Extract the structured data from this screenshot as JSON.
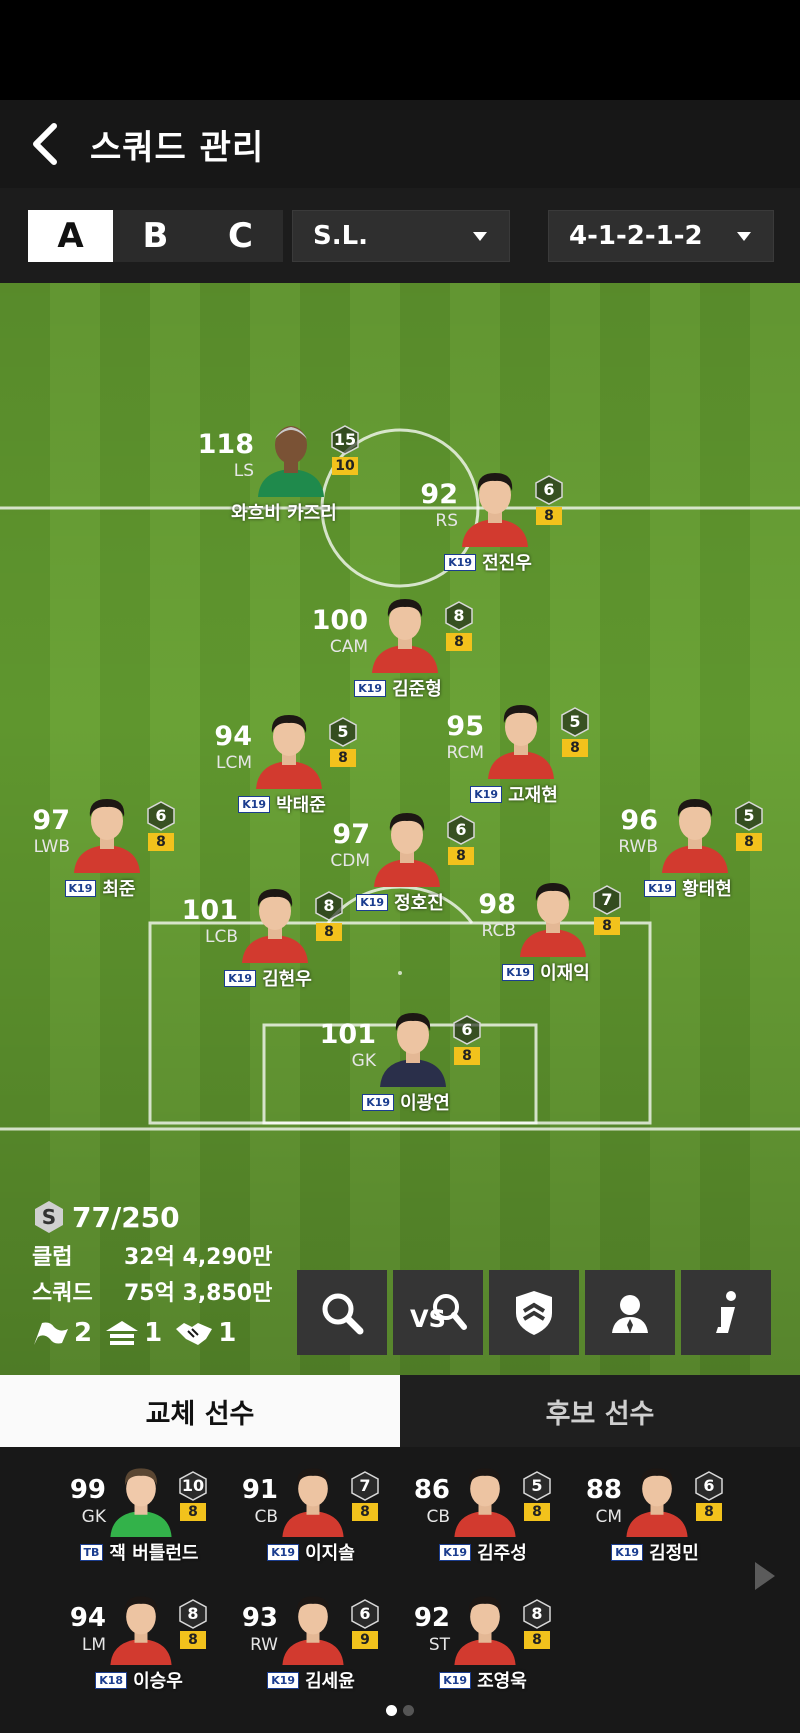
{
  "header": {
    "title": "스쿼드 관리"
  },
  "squad_tabs": [
    {
      "label": "A",
      "active": true
    },
    {
      "label": "B",
      "active": false
    },
    {
      "label": "C",
      "active": false
    }
  ],
  "dropdowns": {
    "squad_select": "S.L.",
    "formation": "4-1-2-1-2"
  },
  "players": [
    {
      "ovr": "118",
      "pos": "LS",
      "name": "와흐비 카즈리",
      "badge": "",
      "hex": "15",
      "lvl": "10",
      "kit": "green"
    },
    {
      "ovr": "92",
      "pos": "RS",
      "name": "전진우",
      "badge": "K19",
      "hex": "6",
      "lvl": "8",
      "kit": "red"
    },
    {
      "ovr": "100",
      "pos": "CAM",
      "name": "김준형",
      "badge": "K19",
      "hex": "8",
      "lvl": "8",
      "kit": "red"
    },
    {
      "ovr": "94",
      "pos": "LCM",
      "name": "박태준",
      "badge": "K19",
      "hex": "5",
      "lvl": "8",
      "kit": "red"
    },
    {
      "ovr": "95",
      "pos": "RCM",
      "name": "고재현",
      "badge": "K19",
      "hex": "5",
      "lvl": "8",
      "kit": "red"
    },
    {
      "ovr": "97",
      "pos": "LWB",
      "name": "최준",
      "badge": "K19",
      "hex": "6",
      "lvl": "8",
      "kit": "red"
    },
    {
      "ovr": "97",
      "pos": "CDM",
      "name": "정호진",
      "badge": "K19",
      "hex": "6",
      "lvl": "8",
      "kit": "red"
    },
    {
      "ovr": "96",
      "pos": "RWB",
      "name": "황태현",
      "badge": "K19",
      "hex": "5",
      "lvl": "8",
      "kit": "red"
    },
    {
      "ovr": "101",
      "pos": "LCB",
      "name": "김현우",
      "badge": "K19",
      "hex": "8",
      "lvl": "8",
      "kit": "red"
    },
    {
      "ovr": "98",
      "pos": "RCB",
      "name": "이재익",
      "badge": "K19",
      "hex": "7",
      "lvl": "8",
      "kit": "red"
    },
    {
      "ovr": "101",
      "pos": "GK",
      "name": "이광연",
      "badge": "K19",
      "hex": "6",
      "lvl": "8",
      "kit": "navy"
    }
  ],
  "stats": {
    "salary_cap": "77/250",
    "club_label": "클럽",
    "club_value": "32억 4,290만",
    "squad_label": "스쿼드",
    "squad_value": "75억 3,850만",
    "chem_a": "2",
    "chem_b": "1",
    "chem_c": "1"
  },
  "tools": [
    "search-icon",
    "vs-search-icon",
    "team-emblem-icon",
    "manager-icon",
    "info-icon"
  ],
  "subs_tabs": [
    {
      "label": "교체 선수",
      "active": true
    },
    {
      "label": "후보 선수",
      "active": false
    }
  ],
  "bench": [
    {
      "ovr": "99",
      "pos": "GK",
      "name": "잭 버틀런드",
      "badge": "TB",
      "hex": "10",
      "lvl": "8"
    },
    {
      "ovr": "91",
      "pos": "CB",
      "name": "이지솔",
      "badge": "K19",
      "hex": "7",
      "lvl": "8"
    },
    {
      "ovr": "86",
      "pos": "CB",
      "name": "김주성",
      "badge": "K19",
      "hex": "5",
      "lvl": "8"
    },
    {
      "ovr": "88",
      "pos": "CM",
      "name": "김정민",
      "badge": "K19",
      "hex": "6",
      "lvl": "8"
    },
    {
      "ovr": "94",
      "pos": "LM",
      "name": "이승우",
      "badge": "K18",
      "hex": "8",
      "lvl": "8"
    },
    {
      "ovr": "93",
      "pos": "RW",
      "name": "김세윤",
      "badge": "K19",
      "hex": "6",
      "lvl": "9"
    },
    {
      "ovr": "92",
      "pos": "ST",
      "name": "조영욱",
      "badge": "K19",
      "hex": "8",
      "lvl": "8"
    }
  ],
  "colors": {
    "pitch_light": "#6aa236",
    "pitch_dark": "#5f962e",
    "level_badge": "#f2c21c",
    "kit_red": "#d23a2f",
    "kit_green": "#1f8a4c"
  },
  "pagination": {
    "pages": 2,
    "current": 1
  }
}
